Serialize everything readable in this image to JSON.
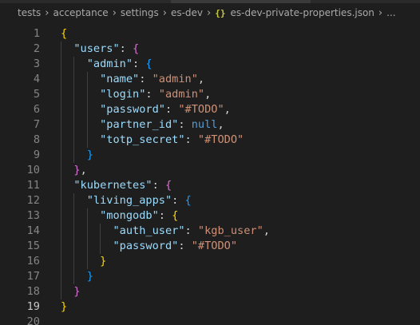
{
  "breadcrumb": {
    "items": [
      "tests",
      "acceptance",
      "settings",
      "es-dev"
    ],
    "file_icon": "{}",
    "file_name": "es-dev-private-properties.json",
    "more": "..."
  },
  "code": {
    "line_numbers": [
      "1",
      "2",
      "3",
      "4",
      "5",
      "6",
      "7",
      "8",
      "9",
      "10",
      "11",
      "12",
      "13",
      "14",
      "15",
      "16",
      "17",
      "18",
      "19",
      "20"
    ],
    "current_line": 19,
    "lines": [
      "{",
      "  \"users\": {",
      "    \"admin\": {",
      "      \"name\": \"admin\",",
      "      \"login\": \"admin\",",
      "      \"password\": \"#TODO\",",
      "      \"partner_id\": null,",
      "      \"totp_secret\": \"#TODO\"",
      "    }",
      "  },",
      "  \"kubernetes\": {",
      "    \"living_apps\": {",
      "      \"mongodb\": {",
      "        \"auth_user\": \"kgb_user\",",
      "        \"password\": \"#TODO\"",
      "      }",
      "    }",
      "  }",
      "}",
      ""
    ]
  },
  "colors": {
    "background": "#1e1e1e",
    "key": "#9cdcfe",
    "string": "#ce9178",
    "null": "#569cd6",
    "bracket_level_1": "#ffd700",
    "bracket_level_2": "#da70d6",
    "bracket_level_3": "#179fff"
  }
}
